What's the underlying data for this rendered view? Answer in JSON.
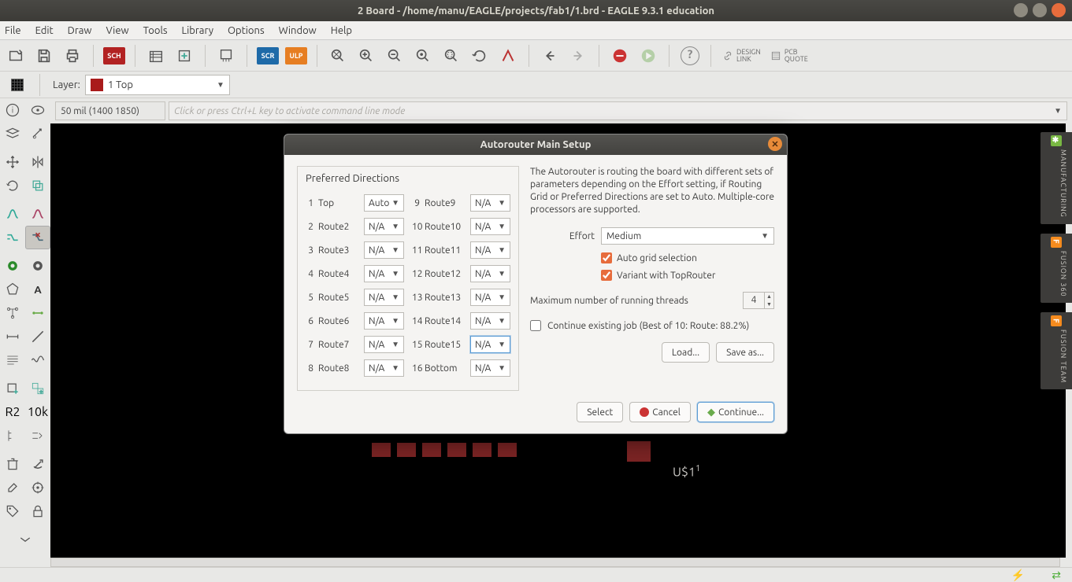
{
  "title": "2 Board - /home/manu/EAGLE/projects/fab1/1.brd - EAGLE 9.3.1 education",
  "menubar": [
    "File",
    "Edit",
    "Draw",
    "View",
    "Tools",
    "Library",
    "Options",
    "Window",
    "Help"
  ],
  "toolbar": {
    "sch": "SCH",
    "scr": "SCR",
    "ulp": "ULP",
    "design_link": "DESIGN\nLINK",
    "pcb_quote": "PCB\nQUOTE"
  },
  "layerrow": {
    "label": "Layer:",
    "value": "1 Top"
  },
  "cmdrow": {
    "coord": "50 mil (1400 1850)",
    "placeholder": "Click or press Ctrl+L key to activate command line mode"
  },
  "right_tabs": [
    "MANUFACTURING",
    "FUSION 360",
    "FUSION TEAM"
  ],
  "canvas": {
    "component": "U$1"
  },
  "dialog": {
    "title": "Autorouter Main Setup",
    "pd_title": "Preferred Directions",
    "layers_left": [
      {
        "n": "1",
        "name": "Top",
        "v": "Auto"
      },
      {
        "n": "2",
        "name": "Route2",
        "v": "N/A"
      },
      {
        "n": "3",
        "name": "Route3",
        "v": "N/A"
      },
      {
        "n": "4",
        "name": "Route4",
        "v": "N/A"
      },
      {
        "n": "5",
        "name": "Route5",
        "v": "N/A"
      },
      {
        "n": "6",
        "name": "Route6",
        "v": "N/A"
      },
      {
        "n": "7",
        "name": "Route7",
        "v": "N/A"
      },
      {
        "n": "8",
        "name": "Route8",
        "v": "N/A"
      }
    ],
    "layers_right": [
      {
        "n": "9",
        "name": "Route9",
        "v": "N/A"
      },
      {
        "n": "10",
        "name": "Route10",
        "v": "N/A"
      },
      {
        "n": "11",
        "name": "Route11",
        "v": "N/A"
      },
      {
        "n": "12",
        "name": "Route12",
        "v": "N/A"
      },
      {
        "n": "13",
        "name": "Route13",
        "v": "N/A"
      },
      {
        "n": "14",
        "name": "Route14",
        "v": "N/A"
      },
      {
        "n": "15",
        "name": "Route15",
        "v": "N/A"
      },
      {
        "n": "16",
        "name": "Bottom",
        "v": "N/A"
      }
    ],
    "desc": "The Autorouter is routing the board with different sets of parameters depending on the Effort setting, if Routing Grid or Preferred Directions are set to Auto. Multiple-core processors are supported.",
    "effort_label": "Effort",
    "effort_value": "Medium",
    "auto_grid": "Auto grid selection",
    "variant": "Variant with TopRouter",
    "threads_label": "Maximum number of running threads",
    "threads_value": "4",
    "continue_job": "Continue existing job (Best of 10: Route: 88.2%)",
    "load": "Load...",
    "save": "Save as...",
    "select": "Select",
    "cancel": "Cancel",
    "continue": "Continue..."
  }
}
